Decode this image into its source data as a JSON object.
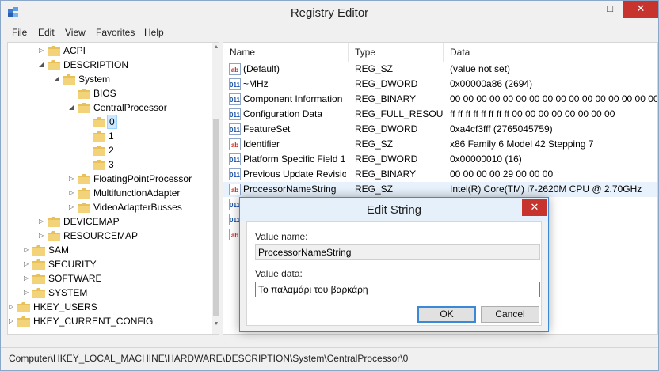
{
  "window": {
    "title": "Registry Editor",
    "minimize_glyph": "—",
    "maximize_glyph": "□",
    "close_glyph": "✕"
  },
  "menu": [
    "File",
    "Edit",
    "View",
    "Favorites",
    "Help"
  ],
  "tree": {
    "items": [
      {
        "label": "ACPI",
        "expander": "▷"
      },
      {
        "label": "DESCRIPTION",
        "expander": "◢"
      },
      {
        "label": "System",
        "expander": "◢"
      },
      {
        "label": "BIOS",
        "expander": ""
      },
      {
        "label": "CentralProcessor",
        "expander": "◢"
      },
      {
        "label": "0",
        "expander": "",
        "selected": true
      },
      {
        "label": "1",
        "expander": ""
      },
      {
        "label": "2",
        "expander": ""
      },
      {
        "label": "3",
        "expander": ""
      },
      {
        "label": "FloatingPointProcessor",
        "expander": "▷"
      },
      {
        "label": "MultifunctionAdapter",
        "expander": "▷"
      },
      {
        "label": "VideoAdapterBusses",
        "expander": "▷"
      },
      {
        "label": "DEVICEMAP",
        "expander": "▷"
      },
      {
        "label": "RESOURCEMAP",
        "expander": "▷"
      },
      {
        "label": "SAM",
        "expander": "▷"
      },
      {
        "label": "SECURITY",
        "expander": "▷"
      },
      {
        "label": "SOFTWARE",
        "expander": "▷"
      },
      {
        "label": "SYSTEM",
        "expander": "▷"
      },
      {
        "label": "HKEY_USERS",
        "expander": "▷"
      },
      {
        "label": "HKEY_CURRENT_CONFIG",
        "expander": "▷"
      }
    ]
  },
  "list": {
    "columns": [
      "Name",
      "Type",
      "Data"
    ],
    "rows": [
      {
        "icon": "string-value-icon",
        "icon_text": "ab",
        "name": "(Default)",
        "type": "REG_SZ",
        "data": "(value not set)"
      },
      {
        "icon": "binary-value-icon",
        "icon_text": "011",
        "name": "~MHz",
        "type": "REG_DWORD",
        "data": "0x00000a86 (2694)"
      },
      {
        "icon": "binary-value-icon",
        "icon_text": "011",
        "name": "Component Information",
        "type": "REG_BINARY",
        "data": "00 00 00 00 00 00 00 00 00 00 00 00 00 00 00 00"
      },
      {
        "icon": "binary-value-icon",
        "icon_text": "011",
        "name": "Configuration Data",
        "type": "REG_FULL_RESOU...",
        "data": "ff ff ff ff ff ff ff ff 00 00 00 00 00 00 00 00"
      },
      {
        "icon": "binary-value-icon",
        "icon_text": "011",
        "name": "FeatureSet",
        "type": "REG_DWORD",
        "data": "0xa4cf3fff (2765045759)"
      },
      {
        "icon": "string-value-icon",
        "icon_text": "ab",
        "name": "Identifier",
        "type": "REG_SZ",
        "data": "x86 Family 6 Model 42 Stepping 7"
      },
      {
        "icon": "binary-value-icon",
        "icon_text": "011",
        "name": "Platform Specific Field 1",
        "type": "REG_DWORD",
        "data": "0x00000010 (16)"
      },
      {
        "icon": "binary-value-icon",
        "icon_text": "011",
        "name": "Previous Update Revision",
        "type": "REG_BINARY",
        "data": "00 00 00 00 29 00 00 00"
      },
      {
        "icon": "string-value-icon",
        "icon_text": "ab",
        "name": "ProcessorNameString",
        "type": "REG_SZ",
        "data": "Intel(R) Core(TM) i7-2620M CPU @ 2.70GHz",
        "selected": true
      },
      {
        "icon": "binary-value-icon",
        "icon_text": "011",
        "name": "",
        "type": "",
        "data": ""
      },
      {
        "icon": "binary-value-icon",
        "icon_text": "011",
        "name": "",
        "type": "",
        "data": ""
      },
      {
        "icon": "string-value-icon",
        "icon_text": "ab",
        "name": "",
        "type": "",
        "data": ""
      }
    ]
  },
  "status": {
    "path": "Computer\\HKEY_LOCAL_MACHINE\\HARDWARE\\DESCRIPTION\\System\\CentralProcessor\\0"
  },
  "dialog": {
    "title": "Edit String",
    "close_glyph": "✕",
    "value_name_label": "Value name:",
    "value_name": "ProcessorNameString",
    "value_data_label": "Value data:",
    "value_data": "Το παλαμάρι του βαρκάρη",
    "ok_label": "OK",
    "cancel_label": "Cancel"
  },
  "colors": {
    "close_red": "#c7342d",
    "selection": "#cce8ff",
    "accent_blue": "#3a88d6",
    "folder_yellow": "#e8c15a"
  }
}
